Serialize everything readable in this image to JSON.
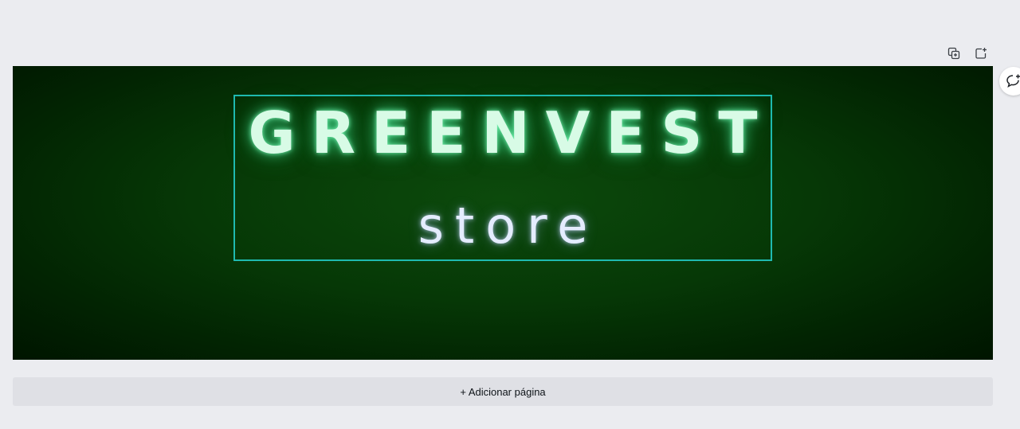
{
  "page_tools": {
    "duplicate_icon": "duplicate-page-icon",
    "add_icon": "add-page-icon"
  },
  "comment": {
    "icon": "add-comment-icon"
  },
  "canvas": {
    "title": "GREENVEST",
    "subtitle": "store",
    "colors": {
      "background": "#063806",
      "title_glow": "#7dffbe",
      "selection": "#1fbab0"
    }
  },
  "add_page": {
    "label": "+ Adicionar página"
  }
}
